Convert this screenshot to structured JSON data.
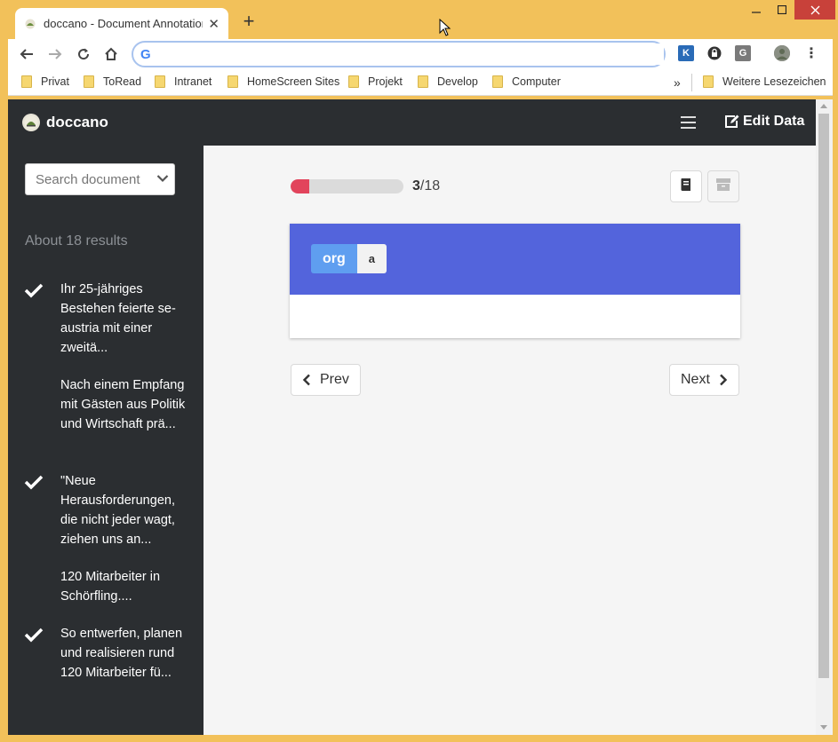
{
  "browser": {
    "tab_title": "doccano - Document Annotation",
    "close_glyph": "✕",
    "newtab_glyph": "+",
    "omnibox_value": "",
    "omnibox_badge": "G",
    "extensions": [
      {
        "name": "k-extension-icon",
        "glyph": "K",
        "color": "#2a6bb7"
      },
      {
        "name": "lock-extension-icon",
        "glyph": "🔒",
        "color": "#555555"
      },
      {
        "name": "g-extension-icon",
        "glyph": "G",
        "color": "#7a7a7a"
      }
    ],
    "menu_glyph": "⋮",
    "bookmarks": [
      "Privat",
      "ToRead",
      "Intranet",
      "HomeScreen Sites",
      "Projekt",
      "Develop",
      "Computer"
    ],
    "bookmarks_overflow": "»",
    "other_bookmarks": "Weitere Lesezeichen"
  },
  "app": {
    "brand": "doccano",
    "edit_label": "Edit Data",
    "search_placeholder": "Search document",
    "results_text": "About 18 results",
    "documents": [
      {
        "text": "Ihr 25-jähriges Bestehen feierte se-austria mit einer zweitä...",
        "checked": true
      },
      {
        "text": "Nach einem Empfang mit Gästen aus Politik und Wirtschaft prä...",
        "checked": false
      },
      {
        "text": "\"Neue Herausforderungen, die nicht jeder wagt, ziehen uns an...",
        "checked": true
      },
      {
        "text": "120 Mitarbeiter in Schörfling....",
        "checked": false
      },
      {
        "text": "So entwerfen, planen und realisieren rund 120 Mitarbeiter fü...",
        "checked": true
      }
    ],
    "progress": {
      "current": "3",
      "separator": "/",
      "total": "18",
      "fraction": 0.1667
    },
    "label": {
      "name": "org",
      "shortcut": "a"
    },
    "prev_label": "Prev",
    "next_label": "Next"
  },
  "colors": {
    "accent_blue": "#5364dc",
    "label_blue": "#5f9ef0",
    "progress_red": "#e2445c",
    "dark": "#2b2e31"
  }
}
